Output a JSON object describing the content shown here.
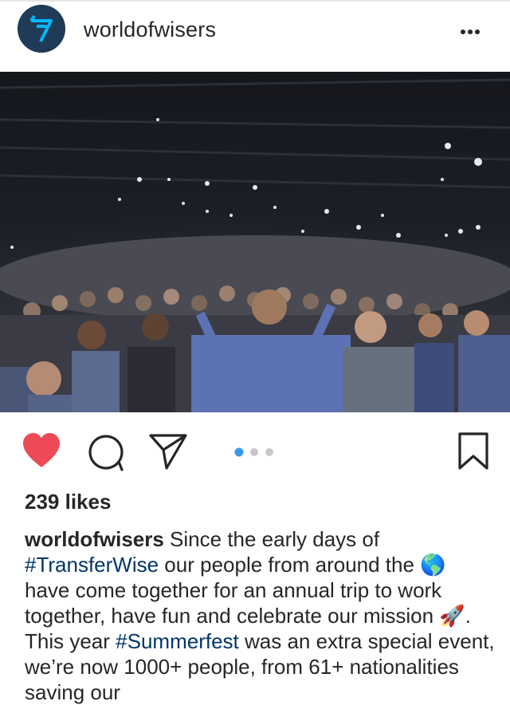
{
  "post": {
    "username": "worldofwisers",
    "likes": "239 likes",
    "carousel": {
      "count": 3,
      "active": 0
    },
    "liked": true,
    "caption": {
      "user": "worldofwisers",
      "part1": " Since the early days of ",
      "hashtag1": "#TransferWise",
      "part2": " our people from around the ",
      "emoji_globe": "🌎",
      "part3": " have come together for an annual trip to work together, have fun and celebrate our mission ",
      "emoji_rocket": "🚀",
      "part4": ". This year ",
      "hashtag2": "#Summerfest",
      "part5": " was an extra special event, we’re now 1000+ people, from 61+ nationalities saving our"
    }
  },
  "icons": {
    "avatar": "transferwise-logo",
    "more": "more-options-icon",
    "like": "heart-icon",
    "comment": "comment-icon",
    "share": "send-icon",
    "save": "bookmark-icon"
  },
  "colors": {
    "heart": "#ed4956",
    "hashtag": "#003569",
    "dot_active": "#3897f0",
    "dot_inactive": "#c7c7c7",
    "avatar_bg": "#1f3b57",
    "logo": "#00b9ff"
  }
}
